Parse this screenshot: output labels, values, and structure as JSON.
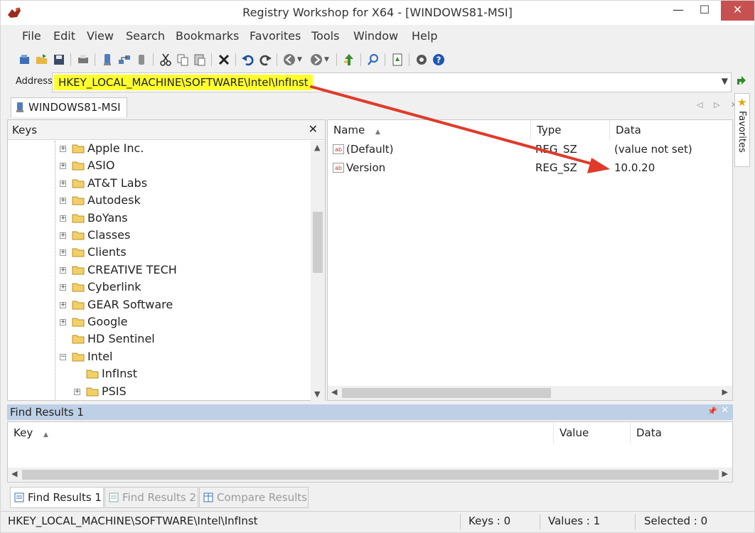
{
  "window": {
    "title": "Registry Workshop for X64 - [WINDOWS81-MSI]",
    "min": "—",
    "max": "☐",
    "close": "✕"
  },
  "menu": [
    "File",
    "Edit",
    "View",
    "Search",
    "Bookmarks",
    "Favorites",
    "Tools",
    "Window",
    "Help"
  ],
  "toolbar": [
    "open-icon",
    "save-icon",
    "print-icon",
    "connect-icon",
    "network-icon",
    "disk-icon",
    "cut-icon",
    "copy-icon",
    "paste-icon",
    "delete-icon",
    "undo-icon",
    "redo-icon",
    "back-icon",
    "forward-icon",
    "up-level-icon",
    "find-icon",
    "export-icon",
    "settings-icon",
    "help-icon"
  ],
  "address": {
    "label": "Address",
    "value": "HKEY_LOCAL_MACHINE\\SOFTWARE\\Intel\\InfInst",
    "highlight": "#ffff2d"
  },
  "doc_tab": {
    "label": "WINDOWS81-MSI",
    "controls": "◁ ▷ ✕"
  },
  "keys_pane": {
    "title": "Keys",
    "close": "✕",
    "items": [
      {
        "label": "Apple Inc.",
        "expandable": true,
        "level": 0
      },
      {
        "label": "ASIO",
        "expandable": true,
        "level": 0
      },
      {
        "label": "AT&T Labs",
        "expandable": true,
        "level": 0
      },
      {
        "label": "Autodesk",
        "expandable": true,
        "level": 0
      },
      {
        "label": "BoYans",
        "expandable": true,
        "level": 0
      },
      {
        "label": "Classes",
        "expandable": true,
        "level": 0
      },
      {
        "label": "Clients",
        "expandable": true,
        "level": 0
      },
      {
        "label": "CREATIVE TECH",
        "expandable": true,
        "level": 0
      },
      {
        "label": "Cyberlink",
        "expandable": true,
        "level": 0
      },
      {
        "label": "GEAR Software",
        "expandable": true,
        "level": 0
      },
      {
        "label": "Google",
        "expandable": true,
        "level": 0
      },
      {
        "label": "HD Sentinel",
        "expandable": false,
        "level": 0
      },
      {
        "label": "Intel",
        "expandable": true,
        "expanded": true,
        "level": 0
      },
      {
        "label": "InfInst",
        "expandable": false,
        "level": 1,
        "selected": true
      },
      {
        "label": "PSIS",
        "expandable": true,
        "level": 1
      }
    ]
  },
  "values_pane": {
    "columns": [
      "Name",
      "Type",
      "Data"
    ],
    "rows": [
      {
        "name": "(Default)",
        "type": "REG_SZ",
        "data": "(value not set)"
      },
      {
        "name": "Version",
        "type": "REG_SZ",
        "data": "10.0.20"
      }
    ]
  },
  "favorites_tab": {
    "label": "Favorites"
  },
  "find_results": {
    "title": "Find Results 1",
    "columns": [
      "Key",
      "Value",
      "Data"
    ]
  },
  "bottom_tabs": [
    {
      "label": "Find Results 1",
      "active": true
    },
    {
      "label": "Find Results 2",
      "active": false
    },
    {
      "label": "Compare Results",
      "active": false
    }
  ],
  "status": {
    "path": "HKEY_LOCAL_MACHINE\\SOFTWARE\\Intel\\InfInst",
    "keys": "Keys : 0",
    "values": "Values : 1",
    "selected": "Selected : 0"
  },
  "colors": {
    "annotation_arrow": "#e03a2a",
    "find_header": "#bdd0e6",
    "close_button": "#c75050"
  }
}
